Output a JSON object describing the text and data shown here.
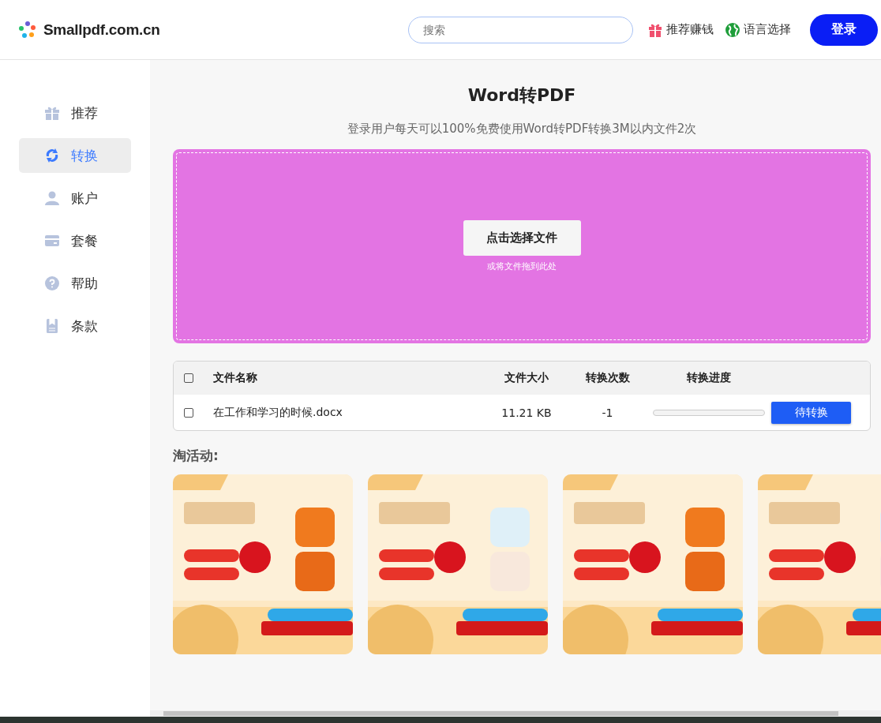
{
  "header": {
    "logo": "Smallpdf.com.cn",
    "search": {
      "placeholder": "搜索"
    },
    "links": [
      {
        "kind": "gift",
        "label": "推荐赚钱"
      },
      {
        "kind": "globe",
        "label": "语言选择"
      }
    ],
    "login": "登录"
  },
  "sidebar": {
    "items": [
      {
        "kind": "gift",
        "label": "推荐",
        "selected": false
      },
      {
        "kind": "convert",
        "label": "转换",
        "selected": true
      },
      {
        "kind": "user",
        "label": "账户",
        "selected": false
      },
      {
        "kind": "card",
        "label": "套餐",
        "selected": false
      },
      {
        "kind": "help",
        "label": "帮助",
        "selected": false
      },
      {
        "kind": "doc",
        "label": "条款",
        "selected": false
      }
    ]
  },
  "title": "Word转PDF",
  "subtitle": "登录用户每天可以100%免费使用Word转PDF转换3M以内文件2次",
  "dropzone": {
    "button": "点击选择文件",
    "hint": "或将文件拖到此处"
  },
  "table": {
    "header_checked": false,
    "columns": [
      "文件名称",
      "文件大小",
      "转换次数",
      "转换进度"
    ],
    "rows": [
      {
        "checked": false,
        "name": "在工作和学习的时候.docx",
        "size": "11.21 KB",
        "count": "-1",
        "level": 0,
        "action": "待转换"
      }
    ]
  },
  "promo": {
    "title": "淘活动:"
  }
}
